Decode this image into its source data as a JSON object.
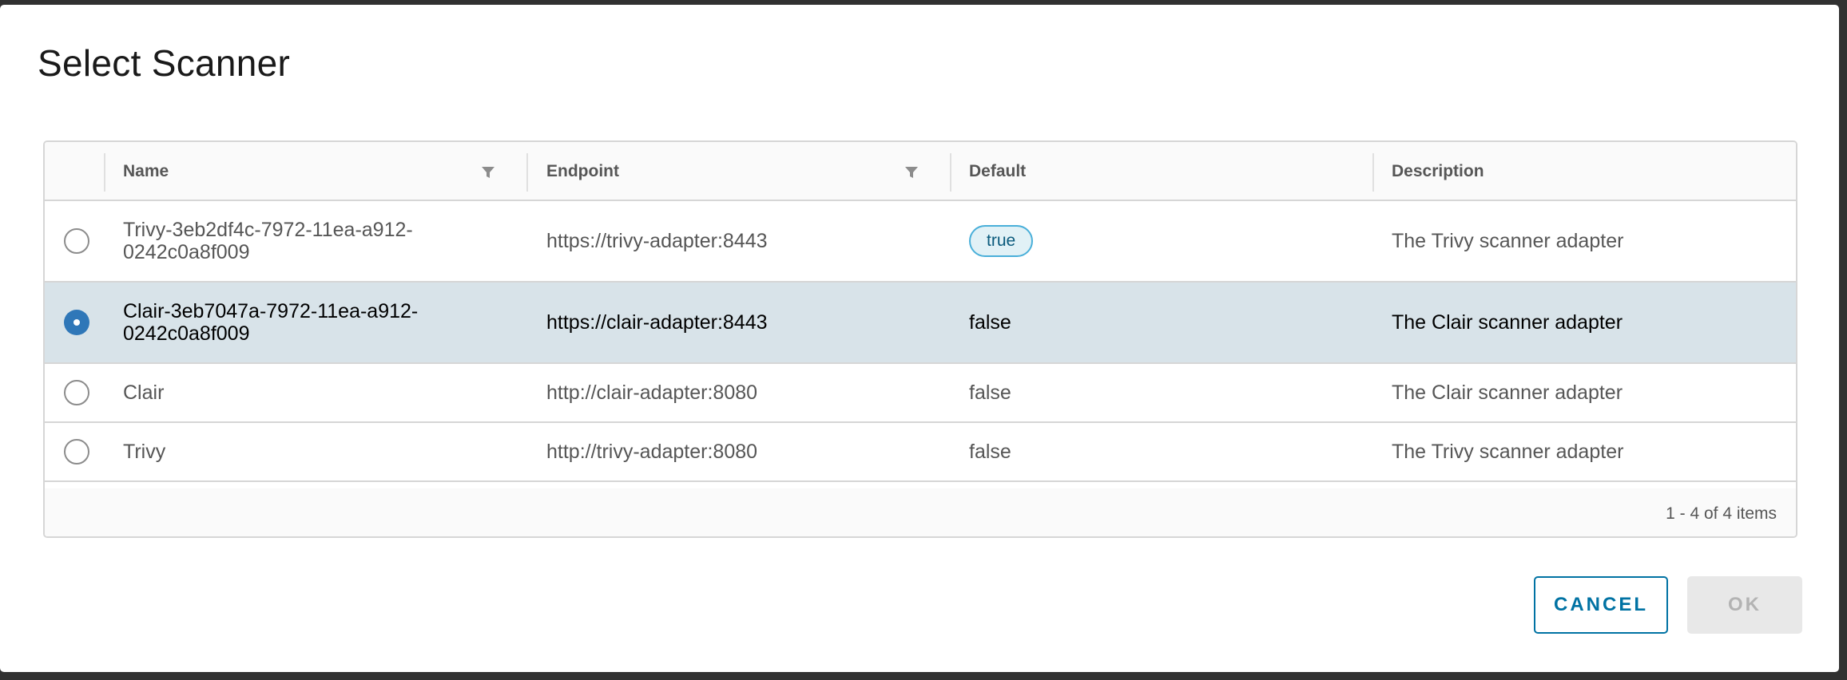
{
  "dialog": {
    "title": "Select Scanner"
  },
  "table": {
    "columns": {
      "name": "Name",
      "endpoint": "Endpoint",
      "default": "Default",
      "description": "Description"
    },
    "rows": [
      {
        "name_line1": "Trivy-3eb2df4c-7972-11ea-a912-",
        "name_line2": "0242c0a8f009",
        "endpoint": "https://trivy-adapter:8443",
        "default": "true",
        "description": "The Trivy scanner adapter",
        "selected": false
      },
      {
        "name_line1": "Clair-3eb7047a-7972-11ea-a912-",
        "name_line2": "0242c0a8f009",
        "endpoint": "https://clair-adapter:8443",
        "default": "false",
        "description": "The Clair scanner adapter",
        "selected": true
      },
      {
        "name_line1": "Clair",
        "name_line2": "",
        "endpoint": "http://clair-adapter:8080",
        "default": "false",
        "description": "The Clair scanner adapter",
        "selected": false
      },
      {
        "name_line1": "Trivy",
        "name_line2": "",
        "endpoint": "http://trivy-adapter:8080",
        "default": "false",
        "description": "The Trivy scanner adapter",
        "selected": false
      }
    ],
    "footer": "1 - 4 of 4 items"
  },
  "buttons": {
    "cancel": "CANCEL",
    "ok": "OK"
  },
  "colors": {
    "accent": "#0072a3",
    "radio_checked": "#2f77b8",
    "selected_row": "#d8e3e9",
    "badge_border": "#49afd9"
  },
  "icons": {
    "filter": "filter-icon"
  }
}
